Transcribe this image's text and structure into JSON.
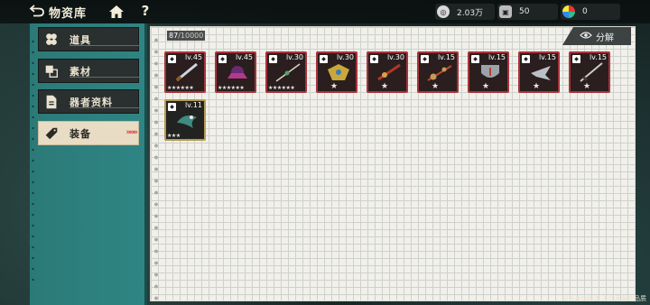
{
  "header": {
    "title": "物资库",
    "currencies": [
      {
        "icon": "coin-icon",
        "value": "2.03万"
      },
      {
        "icon": "ticket-icon",
        "value": "50"
      },
      {
        "icon": "gem-icon",
        "value": "0"
      }
    ]
  },
  "sidebar": {
    "tabs": [
      {
        "label": "道具",
        "icon": "props-icon"
      },
      {
        "label": "素材",
        "icon": "materials-icon"
      },
      {
        "label": "器者资料",
        "icon": "profile-icon"
      },
      {
        "label": "装备",
        "icon": "equipment-icon",
        "active": true,
        "arrows": "»»»"
      }
    ]
  },
  "main": {
    "capacity_current": "87",
    "capacity_max": "/10000",
    "decompose_label": "分解",
    "items": [
      {
        "level": "lv.45",
        "stars": "★★★★★★",
        "rarity": "red",
        "art": "blade"
      },
      {
        "level": "lv.45",
        "stars": "★★★★★★",
        "rarity": "red",
        "art": "orb"
      },
      {
        "level": "lv.30",
        "stars": "★★★★★★",
        "rarity": "red",
        "art": "spear"
      },
      {
        "level": "lv.30",
        "stars": "★",
        "rarity": "red",
        "art": "gauntlet"
      },
      {
        "level": "lv.30",
        "stars": "★",
        "rarity": "red",
        "art": "staff"
      },
      {
        "level": "lv.15",
        "stars": "★",
        "rarity": "red",
        "art": "staff2"
      },
      {
        "level": "lv.15",
        "stars": "★",
        "rarity": "red",
        "art": "shield"
      },
      {
        "level": "lv.15",
        "stars": "★",
        "rarity": "red",
        "art": "claw"
      },
      {
        "level": "lv.15",
        "stars": "★",
        "rarity": "red",
        "art": "sword"
      },
      {
        "level": "lv.11",
        "stars": "★★★",
        "rarity": "gold",
        "art": "bird"
      }
    ]
  },
  "footer": {
    "note": "※开发中版本,不代表最终品质"
  },
  "colors": {
    "sidebar": "#2e8583",
    "rarity_red": "#a8333b",
    "rarity_gold": "#b39a55",
    "active_tab": "#e8dcc4"
  }
}
